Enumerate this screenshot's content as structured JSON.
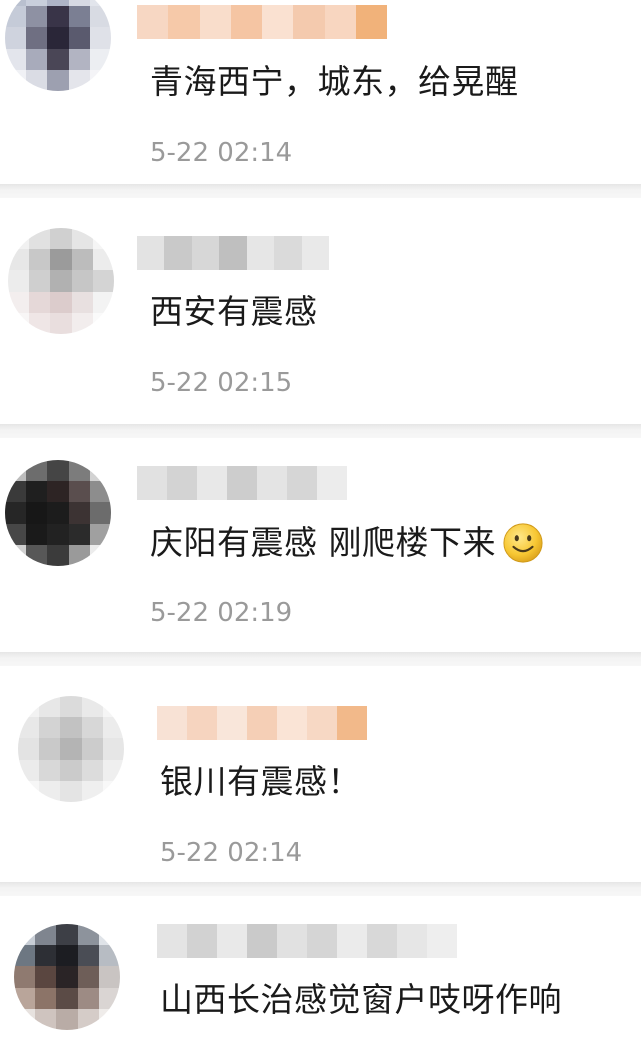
{
  "comments": [
    {
      "text": "青海西宁，城东，给晃醒",
      "time": "5-22 02:14",
      "avatar": "blurred-avatar",
      "name_blur": "pinkish-orange"
    },
    {
      "text": "西安有震感",
      "time": "5-22 02:15",
      "avatar": "blurred-avatar",
      "name_blur": "gray"
    },
    {
      "text": "庆阳有震感 刚爬楼下来",
      "emoji": "smile-emoji",
      "time": "5-22 02:19",
      "avatar": "blurred-avatar",
      "name_blur": "gray"
    },
    {
      "text": "银川有震感！",
      "time": "5-22 02:14",
      "avatar": "blurred-avatar",
      "name_blur": "pinkish-orange"
    },
    {
      "text": "山西长治感觉窗户吱呀作响",
      "time": "",
      "avatar": "blurred-avatar",
      "name_blur": "gray"
    }
  ],
  "colors": {
    "text": "#1a1a1a",
    "timestamp": "#9a9a9a",
    "separator": "#efefef",
    "background": "#ffffff"
  }
}
